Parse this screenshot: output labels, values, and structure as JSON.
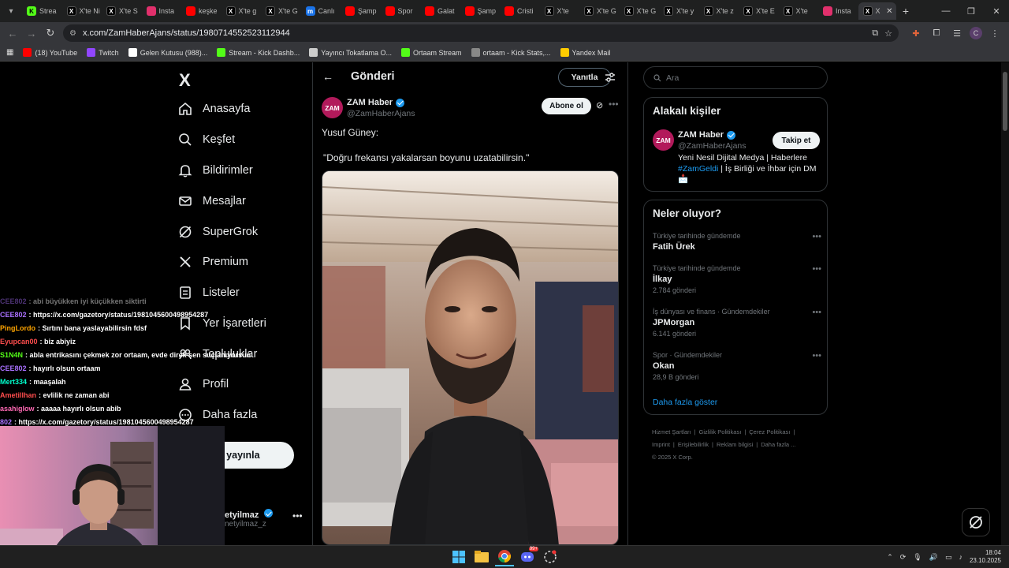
{
  "browser": {
    "tabs": [
      {
        "label": "Strea",
        "icon": "kick-icon",
        "color": "#53fc18"
      },
      {
        "label": "X'te Ni",
        "icon": "x-icon",
        "color": "#000000"
      },
      {
        "label": "X'te S",
        "icon": "x-icon",
        "color": "#000000"
      },
      {
        "label": "Insta",
        "icon": "instagram-icon",
        "color": "#e1306c"
      },
      {
        "label": "keşke",
        "icon": "youtube-icon",
        "color": "#ff0000"
      },
      {
        "label": "X'te g",
        "icon": "x-icon",
        "color": "#000000"
      },
      {
        "label": "X'te G",
        "icon": "x-icon",
        "color": "#000000"
      },
      {
        "label": "Canlı",
        "icon": "m-icon",
        "color": "#1a73e8"
      },
      {
        "label": "Şamp",
        "icon": "youtube-icon",
        "color": "#ff0000"
      },
      {
        "label": "Spor",
        "icon": "youtube-icon",
        "color": "#ff0000"
      },
      {
        "label": "Galat",
        "icon": "youtube-icon",
        "color": "#ff0000"
      },
      {
        "label": "Şamp",
        "icon": "youtube-icon",
        "color": "#ff0000"
      },
      {
        "label": "Cristi",
        "icon": "youtube-icon",
        "color": "#ff0000"
      },
      {
        "label": "X'te",
        "icon": "x-icon",
        "color": "#000000"
      },
      {
        "label": "X'te G",
        "icon": "x-icon",
        "color": "#000000"
      },
      {
        "label": "X'te G",
        "icon": "x-icon",
        "color": "#000000"
      },
      {
        "label": "X'te y",
        "icon": "x-icon",
        "color": "#000000"
      },
      {
        "label": "X'te z",
        "icon": "x-icon",
        "color": "#000000"
      },
      {
        "label": "X'te E",
        "icon": "x-icon",
        "color": "#000000"
      },
      {
        "label": "X'te",
        "icon": "x-icon",
        "color": "#000000"
      },
      {
        "label": "Insta",
        "icon": "instagram-icon",
        "color": "#e1306c"
      },
      {
        "label": "X",
        "icon": "x-icon",
        "color": "#000000",
        "active": true
      }
    ],
    "new_tab": "+",
    "url": "x.com/ZamHaberAjans/status/1980714552523112944",
    "bookmarks": [
      {
        "label": "(18) YouTube",
        "color": "#ff0000"
      },
      {
        "label": "Twitch",
        "color": "#9146ff"
      },
      {
        "label": "Gelen Kutusu (988)...",
        "color": "#ffffff"
      },
      {
        "label": "Stream - Kick Dashb...",
        "color": "#53fc18"
      },
      {
        "label": "Yayıncı Tokatlama O...",
        "color": "#cccccc"
      },
      {
        "label": "Ortaam Stream",
        "color": "#53fc18"
      },
      {
        "label": "ortaam - Kick Stats,...",
        "color": "#888888"
      },
      {
        "label": "Yandex Mail",
        "color": "#ffcc00"
      }
    ]
  },
  "nav": {
    "logo": "X",
    "items": [
      {
        "label": "Anasayfa",
        "icon": "home-icon"
      },
      {
        "label": "Keşfet",
        "icon": "search-icon"
      },
      {
        "label": "Bildirimler",
        "icon": "bell-icon"
      },
      {
        "label": "Mesajlar",
        "icon": "mail-icon"
      },
      {
        "label": "SuperGrok",
        "icon": "grok-icon"
      },
      {
        "label": "Premium",
        "icon": "x-icon"
      },
      {
        "label": "Listeler",
        "icon": "list-icon"
      },
      {
        "label": "Yer İşaretleri",
        "icon": "bookmark-icon"
      },
      {
        "label": "Topluluklar",
        "icon": "community-icon"
      },
      {
        "label": "Profil",
        "icon": "profile-icon"
      },
      {
        "label": "Daha fazla",
        "icon": "more-icon"
      }
    ],
    "post_button": "eri yayınla",
    "profile_name": "etyilmaz",
    "profile_handle": "netyilmaz_z"
  },
  "main": {
    "header_title": "Gönderi",
    "reply_button": "Yanıtla",
    "author_name": "ZAM Haber",
    "author_handle": "@ZamHaberAjans",
    "avatar_text": "ZAM",
    "subscribe_button": "Abone ol",
    "text_line1": "Yusuf Güney:",
    "text_line2": "\"Doğru frekansı yakalarsan boyunu uzatabilirsin.\""
  },
  "right": {
    "search_placeholder": "Ara",
    "related_title": "Alakalı kişiler",
    "related_name": "ZAM Haber",
    "related_handle": "@ZamHaberAjans",
    "related_avatar": "ZAM",
    "follow_button": "Takip et",
    "related_bio_1": "Yeni Nesil Dijital Medya | Haberlere",
    "related_bio_tag": "#ZamGeldi",
    "related_bio_2": " | İş Birliği ve İhbar için DM",
    "trends_title": "Neler oluyor?",
    "trends": [
      {
        "category": "Türkiye tarihinde gündemde",
        "name": "Fatih Ürek",
        "count": ""
      },
      {
        "category": "Türkiye tarihinde gündemde",
        "name": "İlkay",
        "count": "2.784 gönderi"
      },
      {
        "category": "İş dünyası ve finans · Gündemdekiler",
        "name": "JPMorgan",
        "count": "6.141 gönderi"
      },
      {
        "category": "Spor · Gündemdekiler",
        "name": "Okan",
        "count": "28,9 B gönderi"
      }
    ],
    "show_more": "Daha fazla göster",
    "footer": [
      "Hizmet Şartları",
      "|",
      "Gizlilik Politikası",
      "|",
      "Çerez Politikası",
      "|",
      "Imprint",
      "|",
      "Erişilebilirlik",
      "|",
      "Reklam bilgisi",
      "|",
      "Daha fazla ...",
      "© 2025 X Corp."
    ]
  },
  "chat": [
    {
      "user": "CEE802",
      "msg": ": abi büyükken iyi küçükken siktirti",
      "color": "#a970ff"
    },
    {
      "user": "CEE802",
      "msg": ": https://x.com/gazetory/status/1981045600498954287",
      "color": "#a970ff"
    },
    {
      "user": "PingLordo",
      "msg": ": Sırtını bana yaslayabilirsin fdsf",
      "color": "#ffa500"
    },
    {
      "user": "Eyupcan00",
      "msg": ": biz abiyiz",
      "color": "#ff4d4d"
    },
    {
      "user": "S1N4N",
      "msg": ": abla entrikasını çekmek zor ortaam, evde direk sen suçlanıyorsun",
      "color": "#53fc18"
    },
    {
      "user": "CEE802",
      "msg": ": hayırlı olsun ortaam",
      "color": "#a970ff"
    },
    {
      "user": "Mert334",
      "msg": ": maaşalah",
      "color": "#00ffcc"
    },
    {
      "user": "Ametillhan",
      "msg": ": evlilik ne zaman abi",
      "color": "#ff4d4d"
    },
    {
      "user": "asahiglow",
      "msg": ": aaaaa hayırlı olsun abib",
      "color": "#ff69b4"
    },
    {
      "user": "802",
      "msg": ": https://x.com/gazetory/status/1981045600498954287",
      "color": "#a970ff"
    }
  ],
  "taskbar": {
    "time": "18:04",
    "date": "23.10.2025",
    "discord_badge": "99+"
  }
}
